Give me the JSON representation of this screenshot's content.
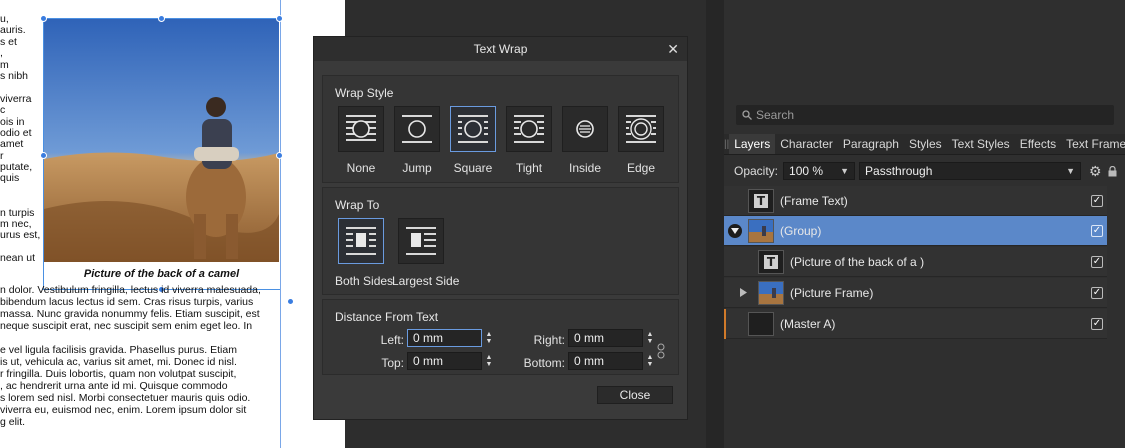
{
  "document": {
    "left_column_lines": [
      "u,",
      "auris.",
      "s et",
      ",",
      "m",
      "s nibh",
      "",
      "viverra",
      "c",
      "ois in",
      "odio et",
      "amet",
      "r",
      "putate,",
      "quis",
      "",
      "",
      "n turpis",
      "m nec,",
      "urus est,",
      "",
      "nean ut"
    ],
    "caption": "Picture of the back of a camel",
    "body_lines": [
      "n dolor. Vestibulum fringilla, lectus id viverra malesuada,",
      "bibendum lacus lectus id sem. Cras risus turpis, varius",
      "massa. Nunc gravida nonummy felis. Etiam suscipit, est",
      "neque suscipit erat, nec suscipit sem enim eget leo. In",
      "",
      "e vel ligula facilisis gravida. Phasellus purus. Etiam",
      "is ut, vehicula ac, varius sit amet, mi. Donec id nisl.",
      "r fringilla. Duis lobortis, quam non volutpat suscipit,",
      ", ac hendrerit urna ante id mi. Quisque commodo",
      "s lorem sed nisl. Morbi consectetuer mauris quis odio.",
      "viverra eu, euismod nec, enim. Lorem ipsum dolor sit",
      "g elit."
    ]
  },
  "dialog": {
    "title": "Text Wrap",
    "wrap_style": {
      "title": "Wrap Style",
      "options": [
        "None",
        "Jump",
        "Square",
        "Tight",
        "Inside",
        "Edge"
      ],
      "selected": "Square"
    },
    "wrap_to": {
      "title": "Wrap To",
      "options": [
        "Both Sides",
        "Largest Side"
      ],
      "selected": "Both Sides"
    },
    "distance": {
      "title": "Distance From Text",
      "left_label": "Left:",
      "left_value": "0 mm",
      "right_label": "Right:",
      "right_value": "0 mm",
      "top_label": "Top:",
      "top_value": "0 mm",
      "bottom_label": "Bottom:",
      "bottom_value": "0 mm"
    },
    "close_label": "Close"
  },
  "panel": {
    "search_placeholder": "Search",
    "tabs": [
      "Layers",
      "Character",
      "Paragraph",
      "Styles",
      "Text Styles",
      "Effects",
      "Text Frame"
    ],
    "active_tab": "Layers",
    "opacity_label": "Opacity:",
    "opacity_value": "100 %",
    "blend_mode": "Passthrough",
    "layers": [
      {
        "name": "(Frame Text)",
        "icon": "text-frame-icon",
        "selected": false
      },
      {
        "name": "(Group)",
        "icon": "image-thumbnail",
        "selected": true
      },
      {
        "name": "(Picture of the back of a )",
        "icon": "text-frame-icon",
        "selected": false
      },
      {
        "name": "(Picture Frame)",
        "icon": "image-thumbnail",
        "selected": false
      },
      {
        "name": "(Master A)",
        "icon": "master-page-icon",
        "selected": false
      }
    ]
  },
  "colors": {
    "accent": "#5b88c9",
    "selection_outline": "#4a90e2",
    "dialog_bg": "#3a3a3a",
    "panel_bg": "#2f2f2f"
  }
}
